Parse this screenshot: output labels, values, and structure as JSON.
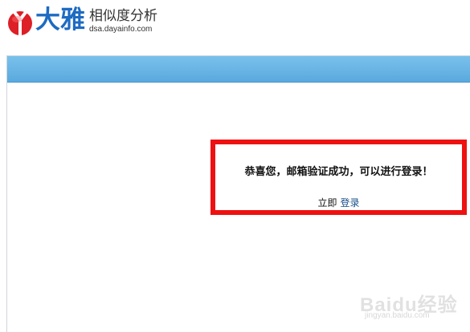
{
  "header": {
    "brand_name": "大雅",
    "tagline": "相似度分析",
    "domain": "dsa.dayainfo.com"
  },
  "colors": {
    "brand_blue": "#1d6bc2",
    "logo_red": "#dd1f26",
    "bar_blue": "#5aa9de",
    "highlight_red": "#ee1111"
  },
  "icons": {
    "logo": "daya-logo-icon"
  },
  "message": {
    "text": "恭喜您，邮箱验证成功，可以进行登录！",
    "login_prefix": "立即",
    "login_link": "登录"
  },
  "watermark": {
    "main": "Baidu经验",
    "sub": "jingyan.baidu.com"
  }
}
